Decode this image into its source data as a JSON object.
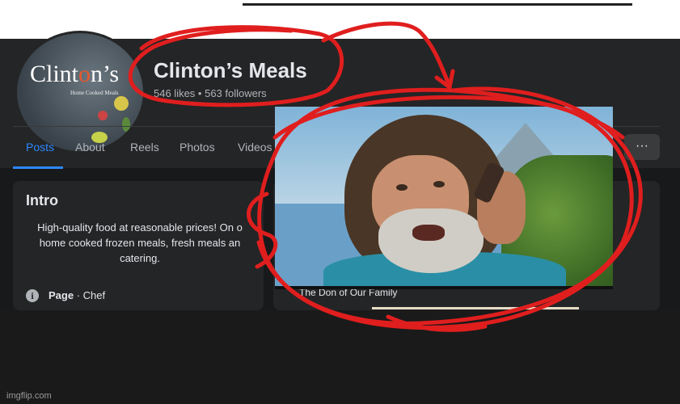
{
  "page": {
    "name": "Clinton’s Meals",
    "stats": "546 likes • 563 followers",
    "avatar_brand_pre": "Clint",
    "avatar_brand_o": "o",
    "avatar_brand_post": "n’s",
    "avatar_subtitle": "Home Cooked Meals"
  },
  "tabs": [
    {
      "label": "Posts",
      "active": true
    },
    {
      "label": "About",
      "active": false
    },
    {
      "label": "Reels",
      "active": false
    },
    {
      "label": "Photos",
      "active": false
    },
    {
      "label": "Videos",
      "active": false
    }
  ],
  "more_button": "···",
  "intro": {
    "title": "Intro",
    "text": "High-quality food at reasonable prices! On o... home cooked frozen meals, fresh meals an... catering.",
    "text_line1": "High-quality food at reasonable prices! On o",
    "text_line2": "home cooked frozen meals, fresh meals an",
    "text_line3": "catering.",
    "info_icon": "i",
    "category_label": "Page",
    "category_value": " · Chef"
  },
  "post": {
    "caption": "The Don of Our Family"
  },
  "watermark": "imgflip.com",
  "colors": {
    "annotation_red": "#e01e1e",
    "fb_blue": "#2d88ff",
    "fb_dark": "#18191a",
    "fb_card": "#242526"
  }
}
